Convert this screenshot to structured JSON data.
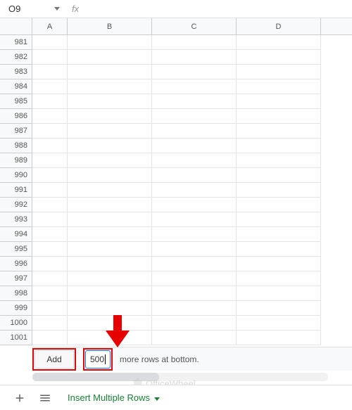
{
  "namebox": {
    "cell_ref": "O9",
    "fx_label": "fx",
    "formula": ""
  },
  "columns": [
    "A",
    "B",
    "C",
    "D"
  ],
  "rows": [
    981,
    982,
    983,
    984,
    985,
    986,
    987,
    988,
    989,
    990,
    991,
    992,
    993,
    994,
    995,
    996,
    997,
    998,
    999,
    1000,
    1001
  ],
  "add_rows": {
    "button_label": "Add",
    "count_value": "500",
    "suffix_text": "more rows at bottom."
  },
  "watermark": {
    "text": "OfficeWheel"
  },
  "tabs": {
    "sheet_name": "Insert Multiple Rows"
  },
  "colors": {
    "highlight": "#e60000",
    "brand_green": "#188038",
    "input_focus": "#1a73e8"
  }
}
